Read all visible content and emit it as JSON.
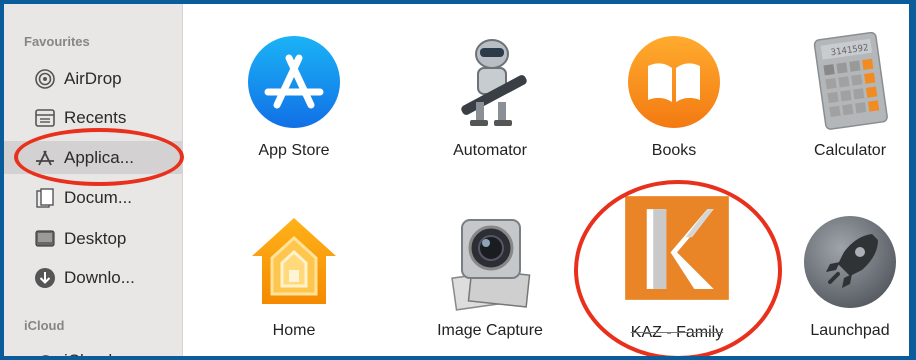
{
  "sidebar": {
    "favourites_title": "Favourites",
    "icloud_title": "iCloud",
    "items": [
      {
        "label": "AirDrop",
        "icon": "airdrop-icon"
      },
      {
        "label": "Recents",
        "icon": "recents-icon"
      },
      {
        "label": "Applica...",
        "icon": "applications-icon"
      },
      {
        "label": "Docum...",
        "icon": "documents-icon"
      },
      {
        "label": "Desktop",
        "icon": "desktop-icon"
      },
      {
        "label": "Downlo...",
        "icon": "downloads-icon"
      },
      {
        "label": "iCloud",
        "icon": "icloud-icon"
      }
    ]
  },
  "apps": [
    {
      "label": "App Store",
      "icon": "app-store-icon"
    },
    {
      "label": "Automator",
      "icon": "automator-icon"
    },
    {
      "label": "Books",
      "icon": "books-icon"
    },
    {
      "label": "Calculator",
      "icon": "calculator-icon"
    },
    {
      "label": "Home",
      "icon": "home-icon"
    },
    {
      "label": "Image Capture",
      "icon": "image-capture-icon"
    },
    {
      "label": "KAZ - Family",
      "icon": "kaz-family-icon"
    },
    {
      "label": "Launchpad",
      "icon": "launchpad-icon"
    }
  ],
  "calculator_display": "3141592",
  "colors": {
    "frame": "#0b5c9a",
    "highlight_ring": "#e8301c",
    "sidebar_bg": "#e9e7e6",
    "selected_bg": "#d3d1d1"
  }
}
